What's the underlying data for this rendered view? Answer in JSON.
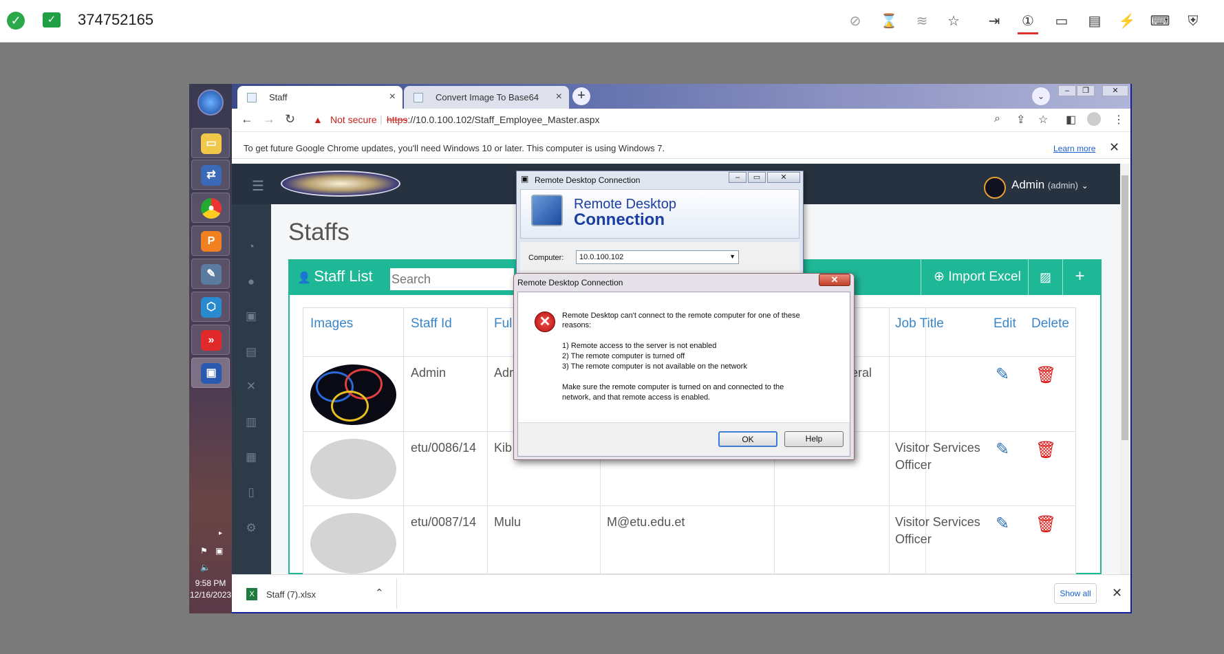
{
  "remote_toolbar": {
    "session_id": "374752165"
  },
  "browser": {
    "tabs": [
      {
        "label": "Staff"
      },
      {
        "label": "Convert Image To Base64"
      }
    ],
    "security_label": "Not secure",
    "url_scheme": "https",
    "url_rest": "://10.0.100.102/Staff_Employee_Master.aspx",
    "info_bar_text": "To get future Google Chrome updates, you'll need Windows 10 or later. This computer is using Windows 7.",
    "info_bar_link": "Learn more"
  },
  "app": {
    "user_name": "Admin",
    "user_role": "(admin)",
    "page_title": "Staffs",
    "panel_title": "Staff List",
    "search_placeholder": "Search",
    "import_button": "Import Excel",
    "table": {
      "headers": [
        "Images",
        "Staff Id",
        "Ful",
        "Job Title",
        "Edit",
        "Delete"
      ],
      "rows": [
        {
          "staff_id": "Admin",
          "name": "Adr",
          "email": "",
          "dept": "eral",
          "job_title_line1": "",
          "job_title_line2": ""
        },
        {
          "staff_id": "etu/0086/14",
          "name": "Kib",
          "email": "",
          "dept": "",
          "job_title_line1": "Visitor Services",
          "job_title_line2": "Officer"
        },
        {
          "staff_id": "etu/0087/14",
          "name": "Mulu",
          "email": "M@etu.edu.et",
          "dept": "",
          "job_title_line1": "Visitor Services",
          "job_title_line2": "Officer"
        }
      ]
    }
  },
  "rdc_window": {
    "title": "Remote Desktop Connection",
    "banner_line1": "Remote Desktop",
    "banner_line2": "Connection",
    "computer_label": "Computer:",
    "computer_value": "10.0.100.102"
  },
  "error_dialog": {
    "title": "Remote Desktop Connection",
    "message_line1": "Remote Desktop can't connect to the remote computer for one of these",
    "message_line2": "reasons:",
    "reason1": "1) Remote access to the server is not enabled",
    "reason2": "2) The remote computer is turned off",
    "reason3": "3) The remote computer is not available on the network",
    "advice_line1": "Make sure the remote computer is turned on and connected to the",
    "advice_line2": "network, and that remote access is enabled.",
    "ok_label": "OK",
    "help_label": "Help"
  },
  "downloads": {
    "file_name": "Staff (7).xlsx",
    "show_all": "Show all"
  },
  "taskbar": {
    "time": "9:58 PM",
    "date": "12/16/2023"
  }
}
